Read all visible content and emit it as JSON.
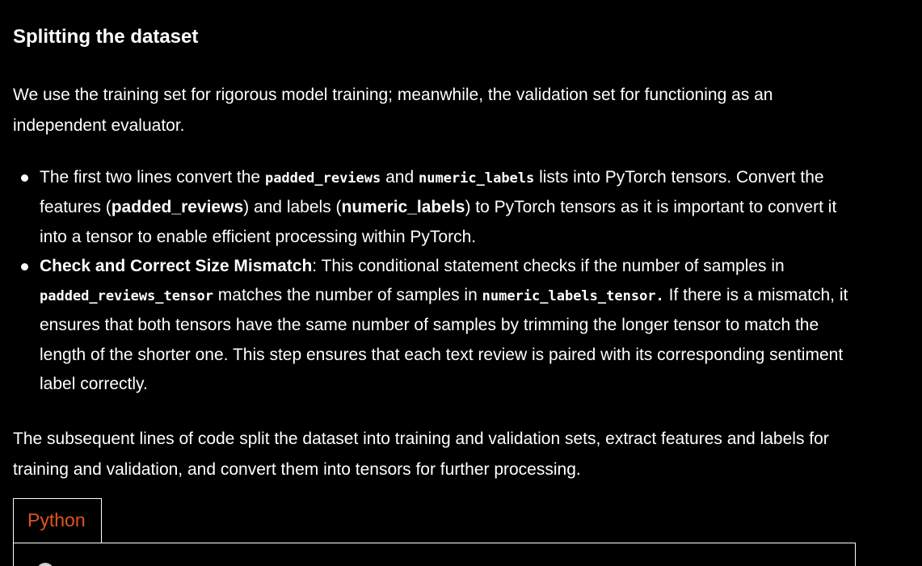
{
  "heading": "Splitting the dataset",
  "intro": "We use the training set for rigorous model training; meanwhile, the validation set for functioning as an independent evaluator.",
  "bullets": [
    {
      "t1": "The first two lines convert the ",
      "c1": "padded_reviews",
      "t2": " and ",
      "c2": "numeric_labels",
      "t3": " lists into PyTorch tensors. Convert the features (",
      "b1": "padded_reviews",
      "t4": ") and labels (",
      "b2": "numeric_labels",
      "t5": ") to PyTorch tensors as it is important to convert it into a tensor to enable efficient processing within PyTorch."
    },
    {
      "b1": "Check and Correct Size Mismatch",
      "t1": ": This conditional statement checks if the number of samples in ",
      "c1": "padded_reviews_tensor",
      "t2": " matches the number of samples in ",
      "c2": "numeric_labels_tensor.",
      "t3": " If there is a mismatch, it ensures that both tensors have the same number of samples by trimming the longer tensor to match the length of the shorter one. This step ensures that each text review is paired with its corresponding sentiment label correctly."
    }
  ],
  "closing": "The subsequent lines of code split the dataset into training and validation sets, extract features and labels for training and validation, and convert them into tensors for further processing.",
  "code_block": {
    "tab_label": "Python"
  },
  "colors": {
    "background": "#000000",
    "text": "#ffffff",
    "tab_accent": "#e0541f"
  }
}
